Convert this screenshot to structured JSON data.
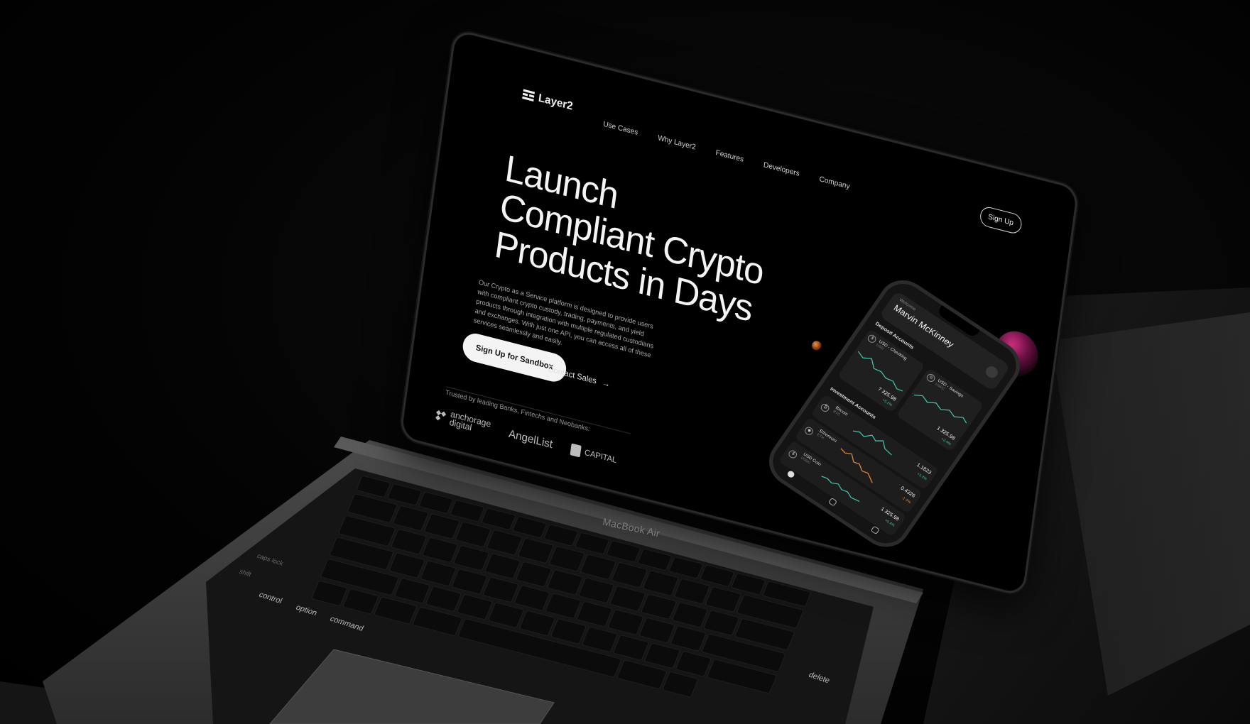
{
  "site": {
    "brand": "Layer2",
    "nav": [
      "Use Cases",
      "Why Layer2",
      "Features",
      "Developers",
      "Company"
    ],
    "signup": "Sign Up",
    "hero_title": "Launch Compliant Crypto Products in Days",
    "hero_body": "Our Crypto as a Service platform is designed to provide users with compliant crypto custody, trading, payments, and yield products through integration with multiple regulated custodians and exchanges. With just one API, you can access all of these services seamlessly and easily.",
    "cta_primary": "Sign Up for Sandbox",
    "cta_secondary": "Contact Sales",
    "cta_arrow": "→",
    "trusted": "Trusted by leading Banks, Fintechs and Neobanks:",
    "partners": {
      "anchorage_line1": "anchorage",
      "anchorage_line2": "digital",
      "angellist": "AngelList",
      "capital": "CAPITAL"
    }
  },
  "phone": {
    "welcome": "Welcome",
    "user_name": "Marvin McKinney",
    "deposit_title": "Deposit Accounts",
    "deposit_accounts": [
      {
        "title": "USD - Checking",
        "sub": "USD",
        "icon": "$",
        "amount": "7 325.98",
        "change": "+5.2%"
      },
      {
        "title": "USD - Savings",
        "sub": "USDC",
        "icon": "◎",
        "amount": "1 325.98",
        "change": "+2.4%"
      }
    ],
    "investment_title": "Investment Accounts",
    "investment_accounts": [
      {
        "name": "Bitcoin",
        "sym": "BTC",
        "icon": "₿",
        "amount": "1.1823",
        "change": "+1.3%",
        "color": "#3fc9b0"
      },
      {
        "name": "Ethereum",
        "sym": "ETH",
        "icon": "◆",
        "amount": "0.4326",
        "change": "-1.4%",
        "color": "#e38a3c"
      },
      {
        "name": "USD Coin",
        "sym": "USDC",
        "icon": "$",
        "amount": "1 325.98",
        "change": "+0.4%",
        "color": "#3fc9b0"
      }
    ]
  },
  "laptop": {
    "model_label": "MacBook Air",
    "keys": {
      "control": "control",
      "option": "option",
      "command": "command",
      "delete": "delete",
      "caps": "caps lock",
      "shift": "shift"
    }
  },
  "colors": {
    "accent_teal": "#3fc9b0",
    "accent_orange": "#e38a3c",
    "background": "#000000"
  }
}
